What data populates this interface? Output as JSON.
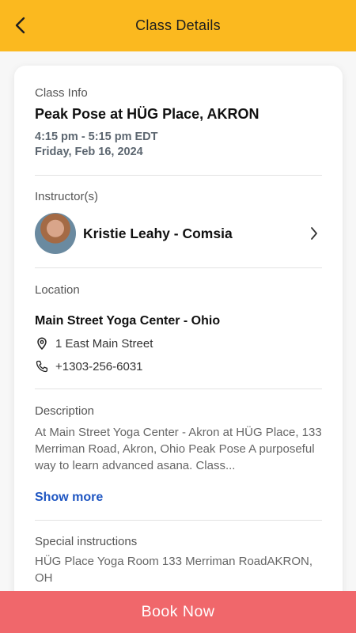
{
  "header": {
    "title": "Class Details",
    "back_icon": "chevron-left-icon",
    "background_color": "#fbb91f"
  },
  "class_info": {
    "label": "Class Info",
    "name": "Peak Pose at HÜG Place, AKRON",
    "time": "4:15 pm - 5:15 pm EDT",
    "date": "Friday, Feb 16, 2024"
  },
  "instructor": {
    "label": "Instructor(s)",
    "name": "Kristie Leahy - Comsia",
    "chevron_icon": "chevron-right-icon"
  },
  "location": {
    "label": "Location",
    "name": "Main Street Yoga Center - Ohio",
    "address": "1 East Main Street",
    "address_icon": "map-pin-icon",
    "phone": "+1303-256-6031",
    "phone_icon": "phone-icon"
  },
  "description": {
    "label": "Description",
    "text": "At Main Street Yoga Center - Akron at HÜG Place, 133 Merriman Road, Akron, Ohio Peak Pose A purposeful way to learn advanced asana. Class...",
    "show_more_label": "Show more",
    "link_color": "#1f56c2"
  },
  "special_instructions": {
    "label": "Special instructions",
    "text": "HÜG Place Yoga Room 133 Merriman RoadAKRON, OH"
  },
  "book_button": {
    "label": "Book Now",
    "color": "#f0676b"
  }
}
